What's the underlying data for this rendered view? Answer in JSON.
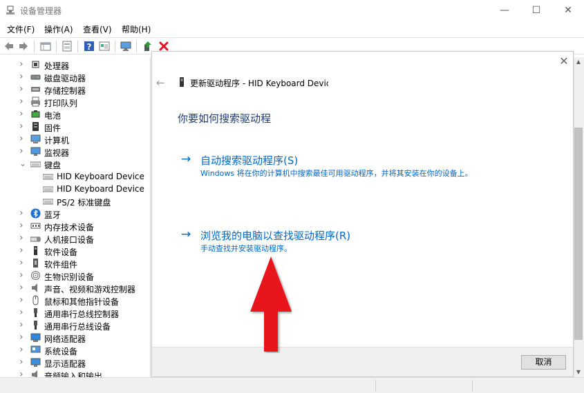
{
  "window": {
    "title": "设备管理器",
    "minimize": "—",
    "maximize": "☐",
    "close": "✕"
  },
  "menu": [
    {
      "label": "文件(F)"
    },
    {
      "label": "操作(A)"
    },
    {
      "label": "查看(V)"
    },
    {
      "label": "帮助(H)"
    }
  ],
  "toolbar": {
    "icons": [
      "back-icon",
      "forward-icon",
      "properties-grid-icon",
      "page-icon",
      "help-icon",
      "view-icon",
      "monitor-icon",
      "update-driver-icon",
      "uninstall-icon"
    ],
    "accent_red": "#e81123"
  },
  "tree": {
    "nodes": [
      {
        "label": "处理器",
        "icon": "processor-icon",
        "expanded": false,
        "indent": 0
      },
      {
        "label": "磁盘驱动器",
        "icon": "disk-drive-icon",
        "expanded": false,
        "indent": 0
      },
      {
        "label": "存储控制器",
        "icon": "storage-controller-icon",
        "expanded": false,
        "indent": 0
      },
      {
        "label": "打印队列",
        "icon": "printer-icon",
        "expanded": false,
        "indent": 0
      },
      {
        "label": "电池",
        "icon": "battery-icon",
        "expanded": false,
        "indent": 0
      },
      {
        "label": "固件",
        "icon": "firmware-icon",
        "expanded": false,
        "indent": 0
      },
      {
        "label": "计算机",
        "icon": "computer-icon",
        "expanded": false,
        "indent": 0
      },
      {
        "label": "监视器",
        "icon": "monitor-icon",
        "expanded": false,
        "indent": 0
      },
      {
        "label": "键盘",
        "icon": "keyboard-icon",
        "expanded": true,
        "indent": 0
      },
      {
        "label": "HID Keyboard Device",
        "icon": "keyboard-icon",
        "expanded": null,
        "indent": 1
      },
      {
        "label": "HID Keyboard Device",
        "icon": "keyboard-icon",
        "expanded": null,
        "indent": 1
      },
      {
        "label": "PS/2 标准键盘",
        "icon": "keyboard-icon",
        "expanded": null,
        "indent": 1
      },
      {
        "label": "蓝牙",
        "icon": "bluetooth-icon",
        "expanded": false,
        "indent": 0
      },
      {
        "label": "内存技术设备",
        "icon": "memory-icon",
        "expanded": false,
        "indent": 0
      },
      {
        "label": "人机接口设备",
        "icon": "hid-icon",
        "expanded": false,
        "indent": 0
      },
      {
        "label": "软件设备",
        "icon": "software-device-icon",
        "expanded": false,
        "indent": 0
      },
      {
        "label": "软件组件",
        "icon": "software-component-icon",
        "expanded": false,
        "indent": 0
      },
      {
        "label": "生物识别设备",
        "icon": "fingerprint-icon",
        "expanded": false,
        "indent": 0
      },
      {
        "label": "声音、视频和游戏控制器",
        "icon": "speaker-icon",
        "expanded": false,
        "indent": 0
      },
      {
        "label": "鼠标和其他指针设备",
        "icon": "mouse-icon",
        "expanded": false,
        "indent": 0
      },
      {
        "label": "通用串行总线控制器",
        "icon": "usb-icon",
        "expanded": false,
        "indent": 0
      },
      {
        "label": "通用串行总线设备",
        "icon": "usb-icon",
        "expanded": false,
        "indent": 0
      },
      {
        "label": "网络适配器",
        "icon": "network-icon",
        "expanded": false,
        "indent": 0
      },
      {
        "label": "系统设备",
        "icon": "system-device-icon",
        "expanded": false,
        "indent": 0
      },
      {
        "label": "显示适配器",
        "icon": "display-adapter-icon",
        "expanded": false,
        "indent": 0
      },
      {
        "label": "音频输入和输出",
        "icon": "audio-icon",
        "expanded": false,
        "indent": 0
      }
    ]
  },
  "dialog": {
    "close": "✕",
    "back": "←",
    "title": "更新驱动程序 - HID Keyboard Device",
    "heading": "你要如何搜索驱动程",
    "options": [
      {
        "title": "自动搜索驱动程序(S)",
        "description": "Windows 将在你的计算机中搜索最佳可用驱动程序，并将其安装在你的设备上。"
      },
      {
        "title": "浏览我的电脑以查找驱动程序(R)",
        "description": "手动查找并安装驱动程序。"
      }
    ],
    "cancel_label": "取消",
    "link_color": "#0066cc",
    "heading_color": "#1f3a73"
  },
  "annotation": {
    "arrow_color": "#e8141b"
  }
}
